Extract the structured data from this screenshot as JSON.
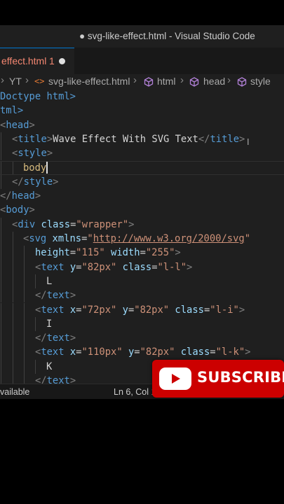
{
  "window": {
    "title": "● svg-like-effect.html - Visual Studio Code"
  },
  "tab": {
    "label": "effect.html",
    "problem_count": "1"
  },
  "breadcrumb": {
    "items": [
      "YT",
      "svg-like-effect.html",
      "html",
      "head",
      "style"
    ]
  },
  "code_lines": [
    [
      "Doctype html>"
    ],
    [
      "tml>"
    ],
    [
      "<",
      "head",
      ">"
    ],
    [
      "<",
      "title",
      ">",
      "Wave Effect With SVG Text",
      "</",
      "title",
      ">"
    ],
    [
      "<",
      "style",
      ">"
    ],
    [
      "body"
    ],
    [
      "</",
      "style",
      ">"
    ],
    [
      "</",
      "head",
      ">"
    ],
    [
      "<",
      "body",
      ">"
    ],
    [
      "<",
      "div",
      " ",
      "class",
      "=",
      "\"wrapper\"",
      ">"
    ],
    [
      "<",
      "svg",
      " ",
      "xmlns",
      "=",
      "\"",
      "http://www.w3.org/2000/svg",
      "\""
    ],
    [
      "height",
      "=",
      "\"115\"",
      " ",
      "width",
      "=",
      "\"255\"",
      ">"
    ],
    [
      "<",
      "text",
      " ",
      "y",
      "=",
      "\"82px\"",
      " ",
      "class",
      "=",
      "\"l-l\"",
      ">"
    ],
    [
      "L"
    ],
    [
      "</",
      "text",
      ">"
    ],
    [
      "<",
      "text",
      " ",
      "x",
      "=",
      "\"72px\"",
      " ",
      "y",
      "=",
      "\"82px\"",
      " ",
      "class",
      "=",
      "\"l-i\"",
      ">"
    ],
    [
      "I"
    ],
    [
      "</",
      "text",
      ">"
    ],
    [
      "<",
      "text",
      " ",
      "x",
      "=",
      "\"110px\"",
      " ",
      "y",
      "=",
      "\"82px\"",
      " ",
      "class",
      "=",
      "\"l-k\"",
      ">"
    ],
    [
      "K"
    ],
    [
      "</",
      "text",
      ">"
    ]
  ],
  "statusbar": {
    "left": "vailable",
    "position": "Ln 6, Col 1"
  },
  "overlay": {
    "subscribe_label": "SUBSCRIBE"
  },
  "colors": {
    "editor_bg": "#1f1f1f",
    "tag": "#569cd6",
    "attribute": "#9cdcfe",
    "string": "#ce9178",
    "punctuation": "#808080",
    "error": "#f48771",
    "subscribe_red": "#cc0000"
  }
}
